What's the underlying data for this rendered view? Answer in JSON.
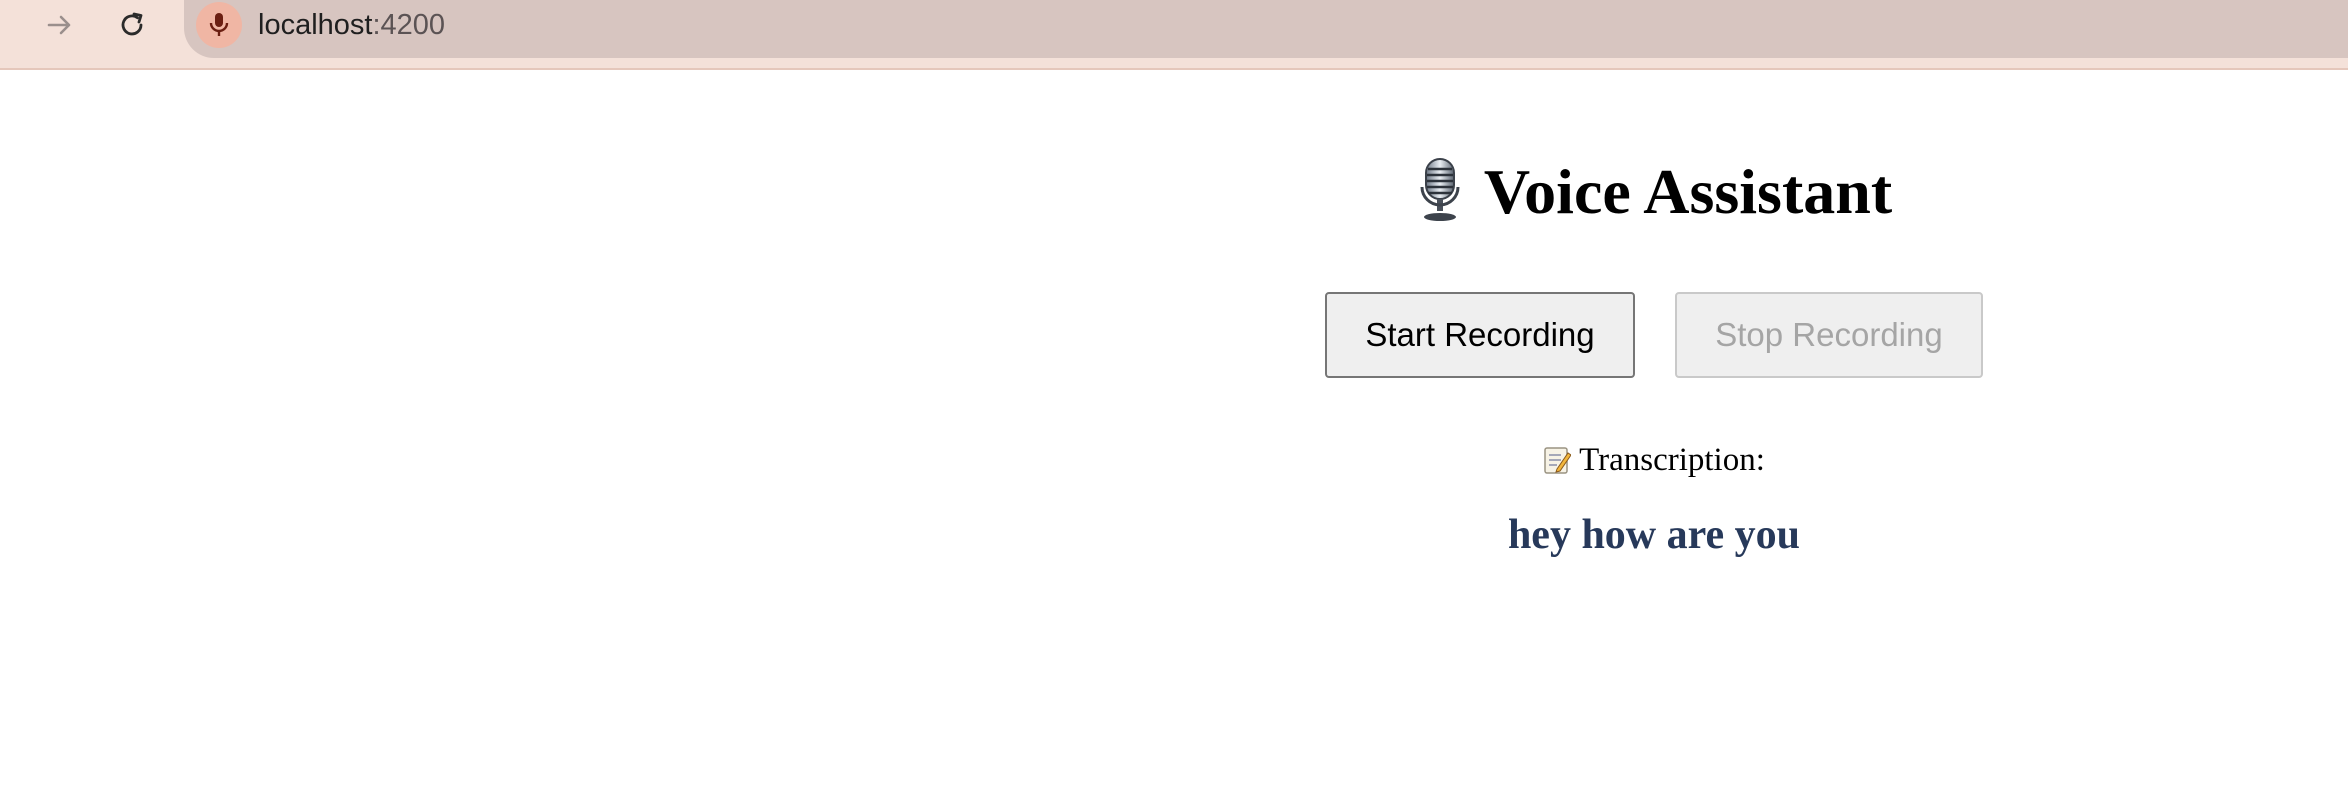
{
  "browser": {
    "url_host": "localhost",
    "url_port": ":4200",
    "icons": {
      "forward": "arrow-right-icon",
      "reload": "reload-icon",
      "mic": "microphone-icon"
    },
    "colors": {
      "bar": "#f4e1d9",
      "omnibox": "#d7c5c0",
      "mic_badge": "#f0b6a4"
    }
  },
  "app": {
    "title": "Voice Assistant",
    "title_icon": "studio-microphone-icon",
    "start_label": "Start Recording",
    "stop_label": "Stop Recording",
    "transcription_label": "Transcription:",
    "transcription_icon": "memo-icon",
    "transcription_text": "hey how are you",
    "colors": {
      "transcription_text": "#27395a"
    }
  }
}
